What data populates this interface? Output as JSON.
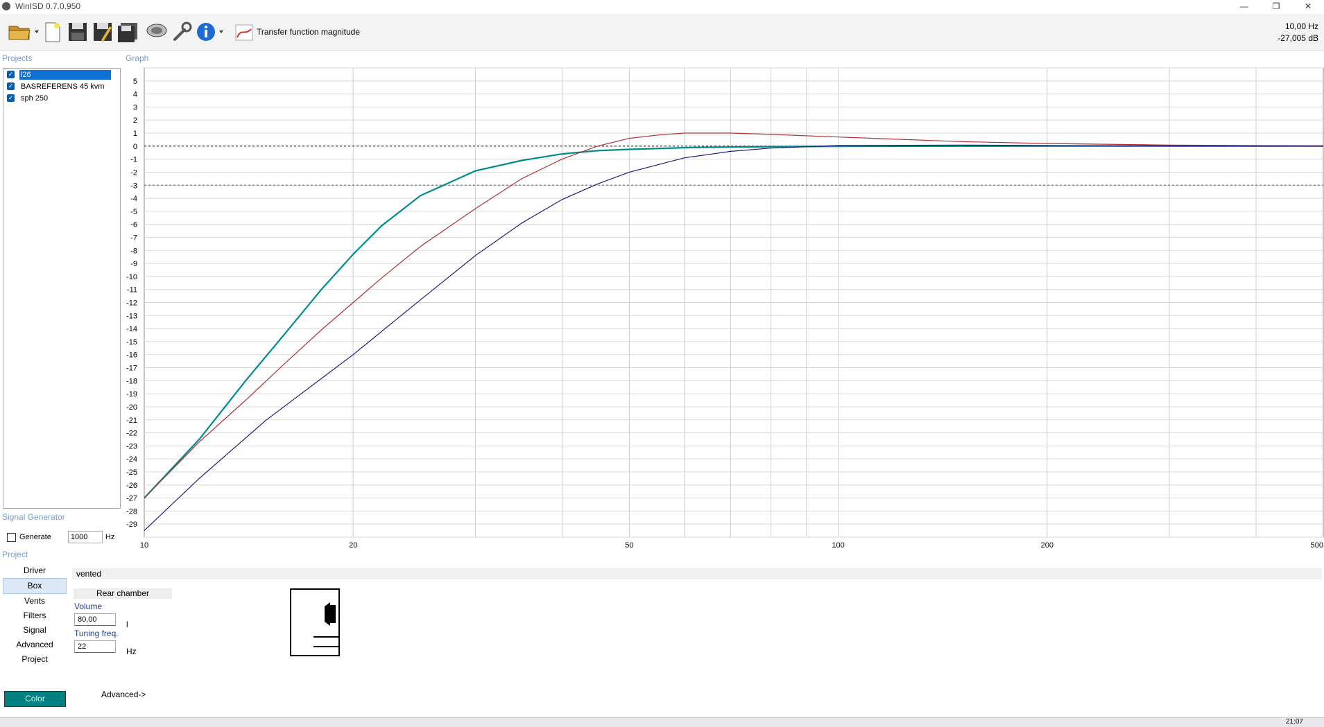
{
  "window": {
    "title": "WinISD 0.7.0.950",
    "minimize": "—",
    "restore": "❐",
    "close": "✕"
  },
  "toolbar": {
    "graph_selector_label": "Transfer function magnitude",
    "cursor_freq": "10,00 Hz",
    "cursor_db": "-27,005 dB"
  },
  "sections": {
    "projects": "Projects",
    "graph": "Graph",
    "signal_generator": "Signal Generator",
    "project": "Project"
  },
  "projects": [
    {
      "name": "l26",
      "checked": true,
      "selected": true
    },
    {
      "name": "BASREFERENS 45 kvm",
      "checked": true,
      "selected": false
    },
    {
      "name": "sph 250",
      "checked": true,
      "selected": false
    }
  ],
  "signal_generator": {
    "generate_label": "Generate",
    "frequency": "1000",
    "unit": "Hz"
  },
  "project_nav": [
    "Driver",
    "Box",
    "Vents",
    "Filters",
    "Signal",
    "Advanced",
    "Project"
  ],
  "color_button": "Color",
  "box_panel": {
    "type": "vented",
    "chamber_header": "Rear chamber",
    "volume_label": "Volume",
    "volume_value": "80,00",
    "volume_unit": "l",
    "tuning_label": "Tuning freq.",
    "tuning_value": "22",
    "tuning_unit": "Hz",
    "advanced_link": "Advanced->"
  },
  "taskbar": {
    "clock": "21:07"
  },
  "colors": {
    "accent": "#0f6fd2",
    "series_teal": "#008b8b",
    "series_red": "#b03030",
    "series_navy": "#1c1c7a"
  },
  "chart_data": {
    "type": "line",
    "x_scale": "log",
    "xlim": [
      10,
      500
    ],
    "ylim": [
      -30,
      6
    ],
    "x_ticks": [
      10,
      20,
      50,
      100,
      200,
      500
    ],
    "y_ticks": [
      5,
      4,
      3,
      2,
      1,
      0,
      -1,
      -2,
      -3,
      -4,
      -5,
      -6,
      -7,
      -8,
      -9,
      -10,
      -11,
      -12,
      -13,
      -14,
      -15,
      -16,
      -17,
      -18,
      -19,
      -20,
      -21,
      -22,
      -23,
      -24,
      -25,
      -26,
      -27,
      -28,
      -29
    ],
    "reference_lines": [
      0,
      -3
    ],
    "series": [
      {
        "color": "#008b8b",
        "x": [
          10,
          12,
          14,
          16,
          18,
          20,
          22,
          25,
          30,
          35,
          40,
          45,
          50,
          60,
          70,
          80,
          100,
          150,
          200,
          300,
          500
        ],
        "y": [
          -27,
          -22.5,
          -18,
          -14.3,
          -11,
          -8.3,
          -6.1,
          -3.8,
          -1.9,
          -1.1,
          -0.6,
          -0.35,
          -0.25,
          -0.12,
          -0.07,
          -0.04,
          -0.02,
          0,
          0,
          0,
          0
        ]
      },
      {
        "color": "#b03030",
        "x": [
          10,
          12,
          14,
          16,
          18,
          20,
          22,
          25,
          30,
          35,
          40,
          45,
          50,
          55,
          60,
          70,
          80,
          100,
          150,
          200,
          300,
          500
        ],
        "y": [
          -27,
          -22.7,
          -19.5,
          -16.6,
          -14.1,
          -12,
          -10.1,
          -7.7,
          -4.8,
          -2.5,
          -1,
          0,
          0.6,
          0.85,
          1,
          1,
          0.9,
          0.7,
          0.35,
          0.2,
          0.08,
          0.02
        ]
      },
      {
        "color": "#1c1c7a",
        "x": [
          10,
          12,
          15,
          20,
          25,
          30,
          35,
          40,
          45,
          50,
          60,
          70,
          80,
          100,
          150,
          200,
          300,
          500
        ],
        "y": [
          -29.5,
          -25.5,
          -21,
          -16,
          -11.8,
          -8.4,
          -5.9,
          -4.1,
          -2.9,
          -2,
          -0.9,
          -0.4,
          -0.15,
          0.05,
          0.08,
          0.05,
          0.02,
          0
        ]
      }
    ]
  }
}
